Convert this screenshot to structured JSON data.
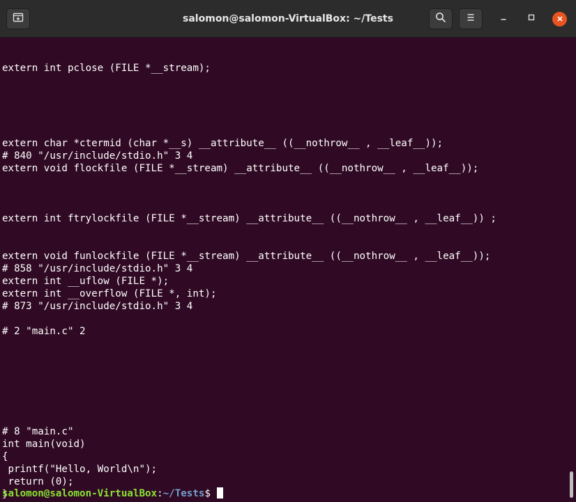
{
  "window": {
    "title": "salomon@salomon-VirtualBox: ~/Tests",
    "buttons": {
      "new_tab_icon": "new-tab-icon",
      "search_icon": "search-icon",
      "menu_icon": "hamburger-menu-icon",
      "minimize_icon": "minimize-icon",
      "maximize_icon": "maximize-icon",
      "close_icon": "close-icon"
    }
  },
  "terminal": {
    "lines": [
      "",
      "extern int pclose (FILE *__stream);",
      "",
      "",
      "",
      "",
      "",
      "extern char *ctermid (char *__s) __attribute__ ((__nothrow__ , __leaf__));",
      "# 840 \"/usr/include/stdio.h\" 3 4",
      "extern void flockfile (FILE *__stream) __attribute__ ((__nothrow__ , __leaf__));",
      "",
      "",
      "",
      "extern int ftrylockfile (FILE *__stream) __attribute__ ((__nothrow__ , __leaf__)) ;",
      "",
      "",
      "extern void funlockfile (FILE *__stream) __attribute__ ((__nothrow__ , __leaf__));",
      "# 858 \"/usr/include/stdio.h\" 3 4",
      "extern int __uflow (FILE *);",
      "extern int __overflow (FILE *, int);",
      "# 873 \"/usr/include/stdio.h\" 3 4",
      "",
      "# 2 \"main.c\" 2",
      "",
      "",
      "",
      "",
      "",
      "",
      "",
      "# 8 \"main.c\"",
      "int main(void)",
      "{",
      " printf(\"Hello, World\\n\");",
      " return (0);",
      "}"
    ],
    "prompt": {
      "user_host": "salomon@salomon-VirtualBox",
      "colon": ":",
      "path": "~/Tests",
      "dollar": "$ "
    }
  },
  "colors": {
    "terminal_bg": "#300a24",
    "titlebar_bg": "#2c2c2c",
    "prompt_user": "#8ae234",
    "prompt_path": "#729fcf",
    "close_button": "#e95420"
  }
}
